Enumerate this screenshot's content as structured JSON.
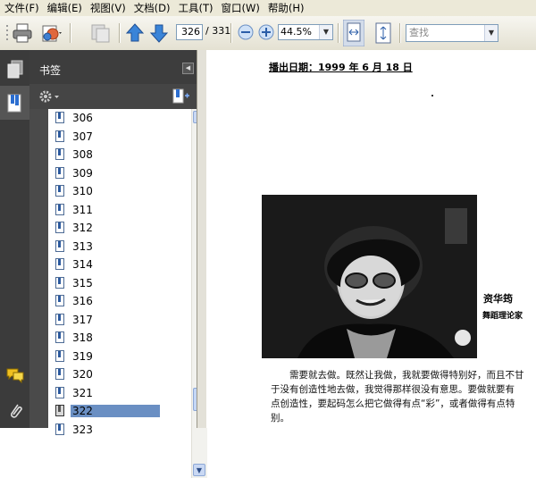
{
  "menu": [
    "文件(F)",
    "编辑(E)",
    "视图(V)",
    "文档(D)",
    "工具(T)",
    "窗口(W)",
    "帮助(H)"
  ],
  "toolbar": {
    "current_page": "326",
    "total_pages": "/ 331",
    "zoom": "44.5%",
    "search_placeholder": "查找"
  },
  "panel": {
    "title": "书签",
    "bookmarks": [
      "306",
      "307",
      "308",
      "309",
      "310",
      "311",
      "312",
      "313",
      "314",
      "315",
      "316",
      "317",
      "318",
      "319",
      "320",
      "321",
      "322",
      "323"
    ],
    "selected": "322"
  },
  "document": {
    "dateline": "播出日期：1999 年 6 月 18 日",
    "person_name": "资华筠",
    "person_role": "舞蹈理论家",
    "body_lines": [
      "需要就去做。既然让我做，我就要做得特别好，而且不甘",
      "于没有创造性地去做，我觉得那样很没有意思。要做就要有",
      "点创造性，要起码怎么把它做得有点“彩”，或者做得有点特",
      "别。"
    ]
  },
  "colors": {
    "panel_bg": "#4a4a4a",
    "selection": "#6a8fc3",
    "toolbar_bg": "#ece9d8"
  }
}
